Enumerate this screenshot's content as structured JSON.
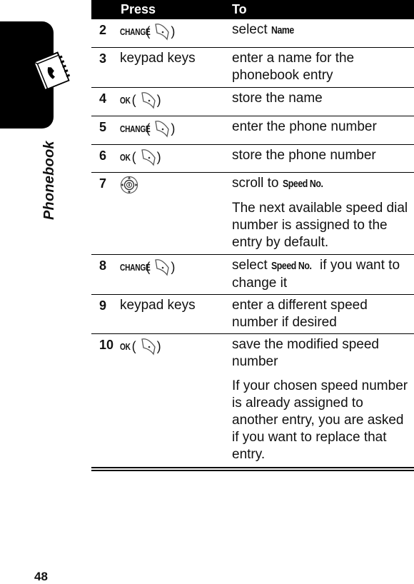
{
  "section": {
    "label": "Phonebook",
    "icon": "phonebook-icon"
  },
  "page_number": "48",
  "table": {
    "headers": {
      "press": "Press",
      "to": "To"
    },
    "rows": [
      {
        "num": "2",
        "press_key": "CHANGE",
        "press_icon": "right-soft-key-icon",
        "to": [
          {
            "text": "select ",
            "keyword": "Name",
            "after": ""
          }
        ]
      },
      {
        "num": "3",
        "press_text": "keypad keys",
        "to": [
          {
            "text": "enter a name for the phonebook entry"
          }
        ]
      },
      {
        "num": "4",
        "press_key": "OK",
        "press_icon": "right-soft-key-icon",
        "to": [
          {
            "text": "store the name"
          }
        ]
      },
      {
        "num": "5",
        "press_key": "CHANGE",
        "press_icon": "right-soft-key-icon",
        "to": [
          {
            "text": "enter the phone number"
          }
        ]
      },
      {
        "num": "6",
        "press_key": "OK",
        "press_icon": "right-soft-key-icon",
        "to": [
          {
            "text": "store the phone number"
          }
        ]
      },
      {
        "num": "7",
        "press_icon": "navigation-key-icon",
        "to": [
          {
            "text": "scroll to ",
            "keyword": "Speed No."
          },
          {
            "text": "The next available speed dial number is assigned to the entry by default."
          }
        ]
      },
      {
        "num": "8",
        "press_key": "CHANGE",
        "press_icon": "right-soft-key-icon",
        "to": [
          {
            "text": "select ",
            "keyword": "Speed No.",
            "after": " if you want to change it"
          }
        ]
      },
      {
        "num": "9",
        "press_text": "keypad keys",
        "to": [
          {
            "text": "enter a different speed number if desired"
          }
        ]
      },
      {
        "num": "10",
        "press_key": "OK",
        "press_icon": "right-soft-key-icon",
        "to": [
          {
            "text": "save the modified speed number"
          },
          {
            "text": "If your chosen speed number is already assigned to another entry, you are asked if you want to replace that entry."
          }
        ]
      }
    ]
  },
  "strings": {
    "open_paren": "(",
    "close_paren": ")"
  }
}
